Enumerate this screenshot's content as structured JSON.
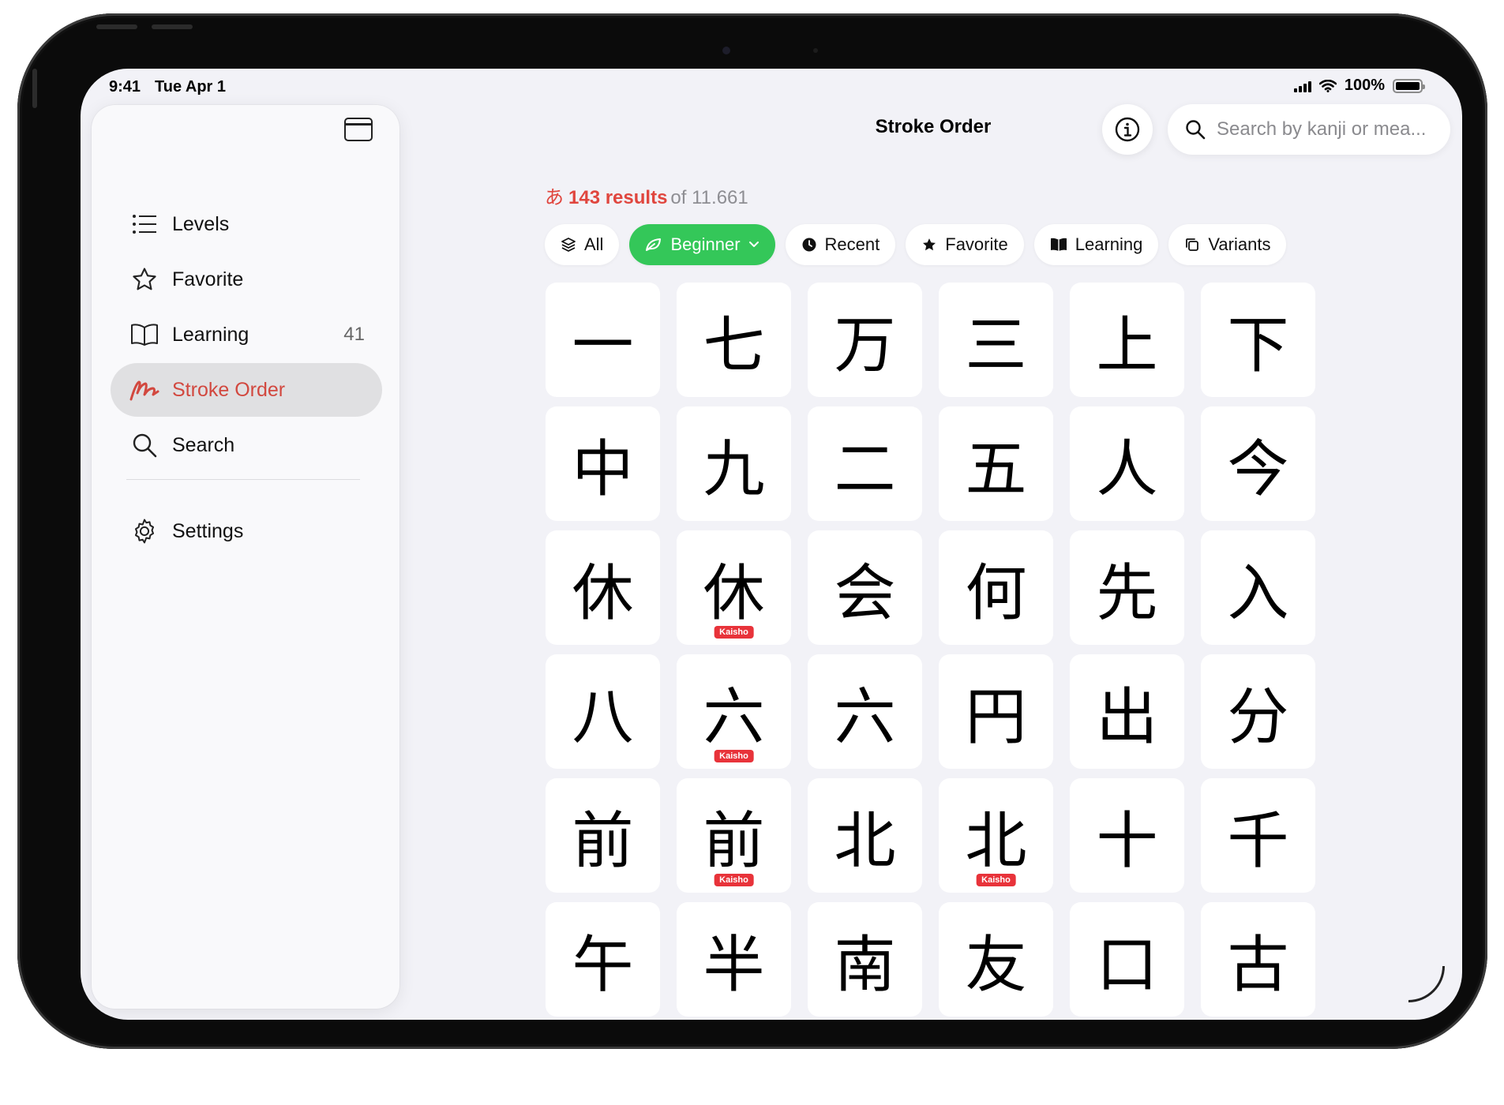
{
  "status": {
    "time": "9:41",
    "date": "Tue Apr 1",
    "battery": "100%"
  },
  "sidebar": {
    "items": [
      {
        "label": "Levels",
        "icon": "list-icon"
      },
      {
        "label": "Favorite",
        "icon": "star-icon"
      },
      {
        "label": "Learning",
        "icon": "book-icon",
        "badge": "41"
      },
      {
        "label": "Stroke Order",
        "icon": "stroke-order-icon",
        "active": true
      },
      {
        "label": "Search",
        "icon": "search-icon"
      },
      {
        "label": "Settings",
        "icon": "gear-icon"
      }
    ]
  },
  "header": {
    "title": "Stroke Order",
    "search_placeholder": "Search by kanji or mea..."
  },
  "results": {
    "kana": "あ",
    "count": "143 results",
    "total": "of 11.661"
  },
  "filters": [
    {
      "label": "All",
      "icon": "layers-icon"
    },
    {
      "label": "Beginner",
      "icon": "leaf-icon",
      "active": true,
      "dropdown": true
    },
    {
      "label": "Recent",
      "icon": "clock-icon"
    },
    {
      "label": "Favorite",
      "icon": "star-fill-icon"
    },
    {
      "label": "Learning",
      "icon": "book-fill-icon"
    },
    {
      "label": "Variants",
      "icon": "copy-icon"
    }
  ],
  "kaisho_label": "Kaisho",
  "kanji": [
    {
      "char": "一"
    },
    {
      "char": "七"
    },
    {
      "char": "万"
    },
    {
      "char": "三"
    },
    {
      "char": "上"
    },
    {
      "char": "下"
    },
    {
      "char": "中"
    },
    {
      "char": "九"
    },
    {
      "char": "二"
    },
    {
      "char": "五"
    },
    {
      "char": "人"
    },
    {
      "char": "今"
    },
    {
      "char": "休"
    },
    {
      "char": "休",
      "kaisho": true
    },
    {
      "char": "会"
    },
    {
      "char": "何"
    },
    {
      "char": "先"
    },
    {
      "char": "入"
    },
    {
      "char": "八"
    },
    {
      "char": "六",
      "kaisho": true
    },
    {
      "char": "六"
    },
    {
      "char": "円"
    },
    {
      "char": "出"
    },
    {
      "char": "分"
    },
    {
      "char": "前"
    },
    {
      "char": "前",
      "kaisho": true
    },
    {
      "char": "北"
    },
    {
      "char": "北",
      "kaisho": true
    },
    {
      "char": "十"
    },
    {
      "char": "千"
    },
    {
      "char": "午"
    },
    {
      "char": "半"
    },
    {
      "char": "南"
    },
    {
      "char": "友"
    },
    {
      "char": "口"
    },
    {
      "char": "古"
    }
  ],
  "colors": {
    "accent": "#d2483f",
    "beginner": "#34c759",
    "kaisho": "#e8333a"
  }
}
